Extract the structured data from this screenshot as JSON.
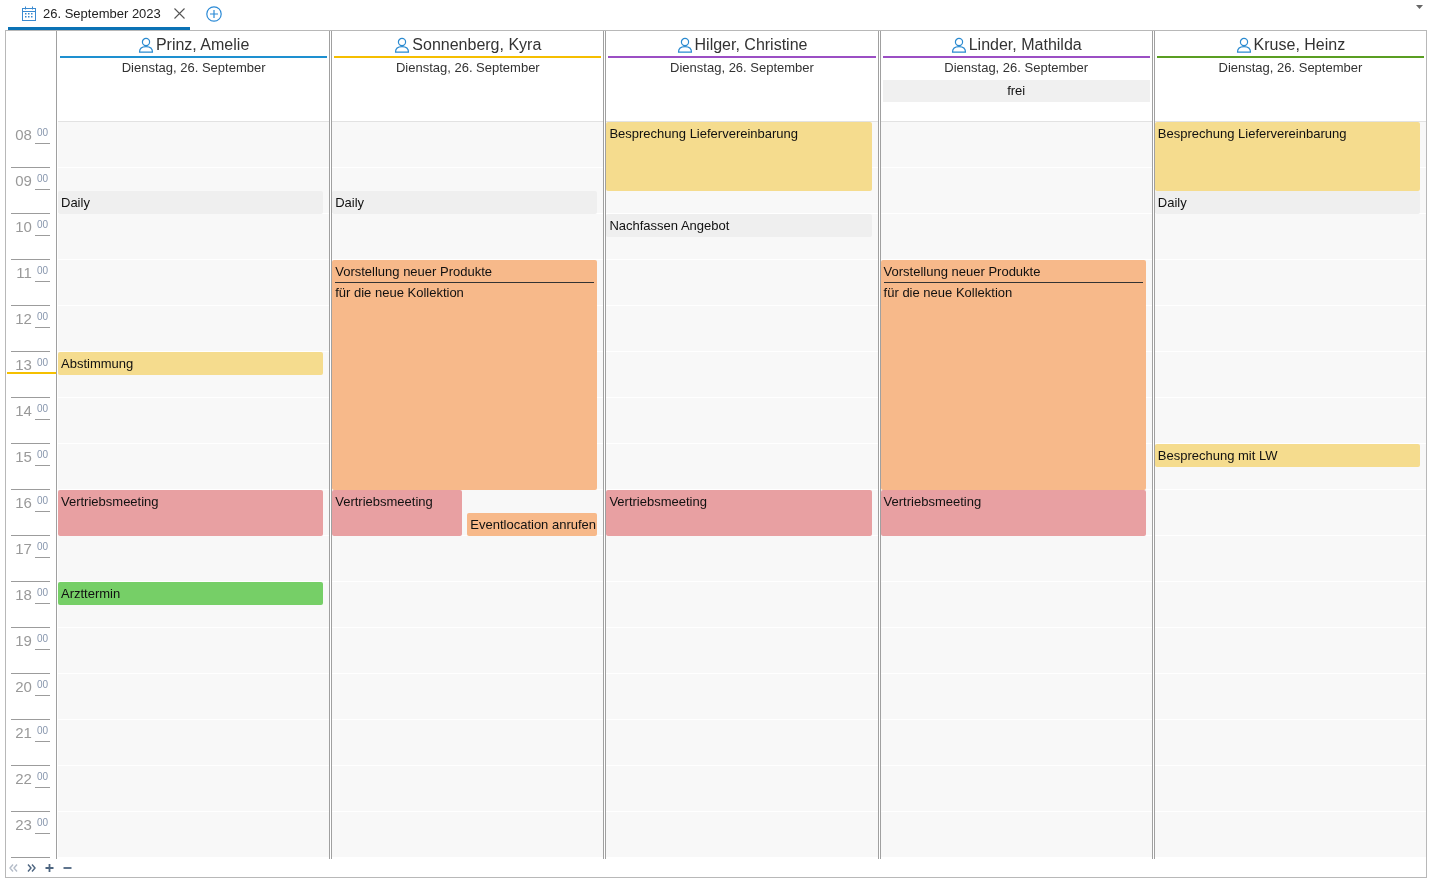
{
  "tabs": [
    {
      "label": "26. September 2023",
      "selected": true
    }
  ],
  "time_axis": {
    "hours": [
      {
        "hour": "08",
        "minutes": "00",
        "current": false
      },
      {
        "hour": "09",
        "minutes": "00",
        "current": false
      },
      {
        "hour": "10",
        "minutes": "00",
        "current": false
      },
      {
        "hour": "11",
        "minutes": "00",
        "current": false
      },
      {
        "hour": "12",
        "minutes": "00",
        "current": false
      },
      {
        "hour": "13",
        "minutes": "00",
        "current": true
      },
      {
        "hour": "14",
        "minutes": "00",
        "current": false
      },
      {
        "hour": "15",
        "minutes": "00",
        "current": false
      },
      {
        "hour": "16",
        "minutes": "00",
        "current": false
      },
      {
        "hour": "17",
        "minutes": "00",
        "current": false
      },
      {
        "hour": "18",
        "minutes": "00",
        "current": false
      },
      {
        "hour": "19",
        "minutes": "00",
        "current": false
      },
      {
        "hour": "20",
        "minutes": "00",
        "current": false
      },
      {
        "hour": "21",
        "minutes": "00",
        "current": false
      },
      {
        "hour": "22",
        "minutes": "00",
        "current": false
      },
      {
        "hour": "23",
        "minutes": "00",
        "current": false
      }
    ]
  },
  "resources": [
    {
      "name": "Prinz, Amelie",
      "color": "#1e90d0",
      "date": "Dienstag, 26. September",
      "half_hour_slots": [
        {
          "kind": "half-hour"
        },
        {
          "kind": "half-hour"
        },
        {
          "kind": "half-hour"
        },
        {
          "kind": "half-hour",
          "appointments": [
            {
              "kind": "half-hour",
              "title": "Daily",
              "color": "#efefef"
            }
          ]
        },
        {
          "kind": "half-hour"
        },
        {
          "kind": "half-hour"
        },
        {
          "kind": "half-hour"
        },
        {
          "kind": "half-hour"
        },
        {
          "kind": "half-hour"
        },
        {
          "kind": "half-hour"
        },
        {
          "kind": "half-hour",
          "appointments": [
            {
              "kind": "half-hour",
              "title": "Abstimmung",
              "color": "#f5dc8e"
            }
          ]
        },
        {
          "kind": "half-hour"
        },
        {
          "kind": "half-hour"
        },
        {
          "kind": "half-hour"
        },
        {
          "kind": "half-hour"
        },
        {
          "kind": "half-hour"
        },
        {
          "kind": "half-hour",
          "appointments": [
            {
              "kind": "hour",
              "title": "Vertriebsmeeting",
              "color": "#e8a0a2"
            }
          ]
        },
        {
          "kind": "half-hour"
        },
        {
          "kind": "half-hour"
        },
        {
          "kind": "half-hour"
        },
        {
          "kind": "half-hour",
          "appointments": [
            {
              "kind": "half-hour",
              "title": "Arzttermin",
              "color": "#76cf67"
            }
          ]
        }
      ]
    },
    {
      "name": "Sonnenberg, Kyra",
      "color": "#f5be00",
      "date": "Dienstag, 26. September",
      "half_hour_slots": [
        {
          "kind": "half-hour"
        },
        {
          "kind": "half-hour"
        },
        {
          "kind": "half-hour"
        },
        {
          "kind": "half-hour",
          "appointments": [
            {
              "kind": "half-hour",
              "title": "Daily",
              "color": "#efefef"
            }
          ]
        },
        {
          "kind": "half-hour"
        },
        {
          "kind": "half-hour"
        },
        {
          "kind": "half-hour",
          "appointments": [
            {
              "kind": "five-hours",
              "title": "Vorstellung neuer Produkte",
              "description": "für die neue Kollektion",
              "color": "#f7b98a"
            }
          ]
        },
        {
          "kind": "half-hour"
        },
        {
          "kind": "half-hour"
        },
        {
          "kind": "half-hour"
        },
        {
          "kind": "half-hour"
        },
        {
          "kind": "half-hour"
        },
        {
          "kind": "half-hour"
        },
        {
          "kind": "half-hour"
        },
        {
          "kind": "half-hour"
        },
        {
          "kind": "half-hour"
        },
        {
          "kind": "half-hour",
          "appointments": [
            {
              "kind": "hour",
              "title": "Vertriebsmeeting",
              "color": "#e8a0a2"
            }
          ]
        },
        {
          "kind": "half-hour",
          "appointments": [
            {
              "kind": "half-hour",
              "title": "Eventlocation anrufen",
              "color": "#f7b98a"
            }
          ]
        }
      ]
    },
    {
      "name": "Hilger, Christine",
      "color": "#9b4fc4",
      "date": "Dienstag, 26. September",
      "half_hour_slots": [
        {
          "kind": "half-hour",
          "appointments": [
            {
              "kind": "ninety-minutes",
              "title": "Besprechung Liefervereinbarung",
              "color": "#f5dc8e"
            }
          ]
        },
        {
          "kind": "half-hour"
        },
        {
          "kind": "half-hour"
        },
        {
          "kind": "half-hour"
        },
        {
          "kind": "half-hour",
          "appointments": [
            {
              "kind": "half-hour",
              "title": "Nachfassen Angebot",
              "color": "#efefef"
            }
          ]
        },
        {
          "kind": "half-hour"
        },
        {
          "kind": "half-hour"
        },
        {
          "kind": "half-hour"
        },
        {
          "kind": "half-hour"
        },
        {
          "kind": "half-hour"
        },
        {
          "kind": "half-hour"
        },
        {
          "kind": "half-hour"
        },
        {
          "kind": "half-hour"
        },
        {
          "kind": "half-hour"
        },
        {
          "kind": "half-hour"
        },
        {
          "kind": "half-hour"
        },
        {
          "kind": "half-hour",
          "appointments": [
            {
              "kind": "hour",
              "title": "Vertriebsmeeting",
              "color": "#e8a0a2"
            }
          ]
        }
      ]
    },
    {
      "name": "Linder, Mathilda",
      "color": "#9b4fc4",
      "date": "Dienstag, 26. September",
      "all_day": [
        {
          "title": "frei"
        }
      ],
      "half_hour_slots": [
        {
          "kind": "half-hour"
        },
        {
          "kind": "half-hour"
        },
        {
          "kind": "half-hour"
        },
        {
          "kind": "half-hour"
        },
        {
          "kind": "half-hour"
        },
        {
          "kind": "half-hour"
        },
        {
          "kind": "half-hour",
          "appointments": [
            {
              "kind": "five-hours",
              "title": "Vorstellung neuer Produkte",
              "description": "für die neue Kollektion",
              "color": "#f7b98a"
            }
          ]
        },
        {
          "kind": "half-hour"
        },
        {
          "kind": "half-hour"
        },
        {
          "kind": "half-hour"
        },
        {
          "kind": "half-hour"
        },
        {
          "kind": "half-hour"
        },
        {
          "kind": "half-hour"
        },
        {
          "kind": "half-hour"
        },
        {
          "kind": "half-hour"
        },
        {
          "kind": "half-hour"
        },
        {
          "kind": "half-hour",
          "appointments": [
            {
              "kind": "hour",
              "title": "Vertriebsmeeting",
              "color": "#e8a0a2"
            }
          ]
        }
      ]
    },
    {
      "name": "Kruse, Heinz",
      "color": "#5a9e22",
      "date": "Dienstag, 26. September",
      "half_hour_slots": [
        {
          "kind": "half-hour",
          "appointments": [
            {
              "kind": "ninety-minutes",
              "title": "Besprechung Liefervereinbarung",
              "color": "#f5dc8e"
            }
          ]
        },
        {
          "kind": "half-hour"
        },
        {
          "kind": "half-hour"
        },
        {
          "kind": "half-hour",
          "appointments": [
            {
              "kind": "half-hour",
              "title": "Daily",
              "color": "#efefef"
            }
          ]
        },
        {
          "kind": "half-hour"
        },
        {
          "kind": "half-hour"
        },
        {
          "kind": "half-hour"
        },
        {
          "kind": "half-hour"
        },
        {
          "kind": "half-hour"
        },
        {
          "kind": "half-hour"
        },
        {
          "kind": "half-hour"
        },
        {
          "kind": "half-hour"
        },
        {
          "kind": "half-hour"
        },
        {
          "kind": "half-hour"
        },
        {
          "kind": "half-hour",
          "appointments": [
            {
              "kind": "half-hour",
              "title": "Besprechung mit LW",
              "color": "#f5dc8e"
            }
          ]
        }
      ]
    }
  ],
  "footer_buttons": [
    {
      "kind": "previous",
      "disabled": true
    },
    {
      "kind": "next",
      "disabled": false
    },
    {
      "kind": "add",
      "disabled": false
    },
    {
      "kind": "remove",
      "disabled": false
    }
  ]
}
